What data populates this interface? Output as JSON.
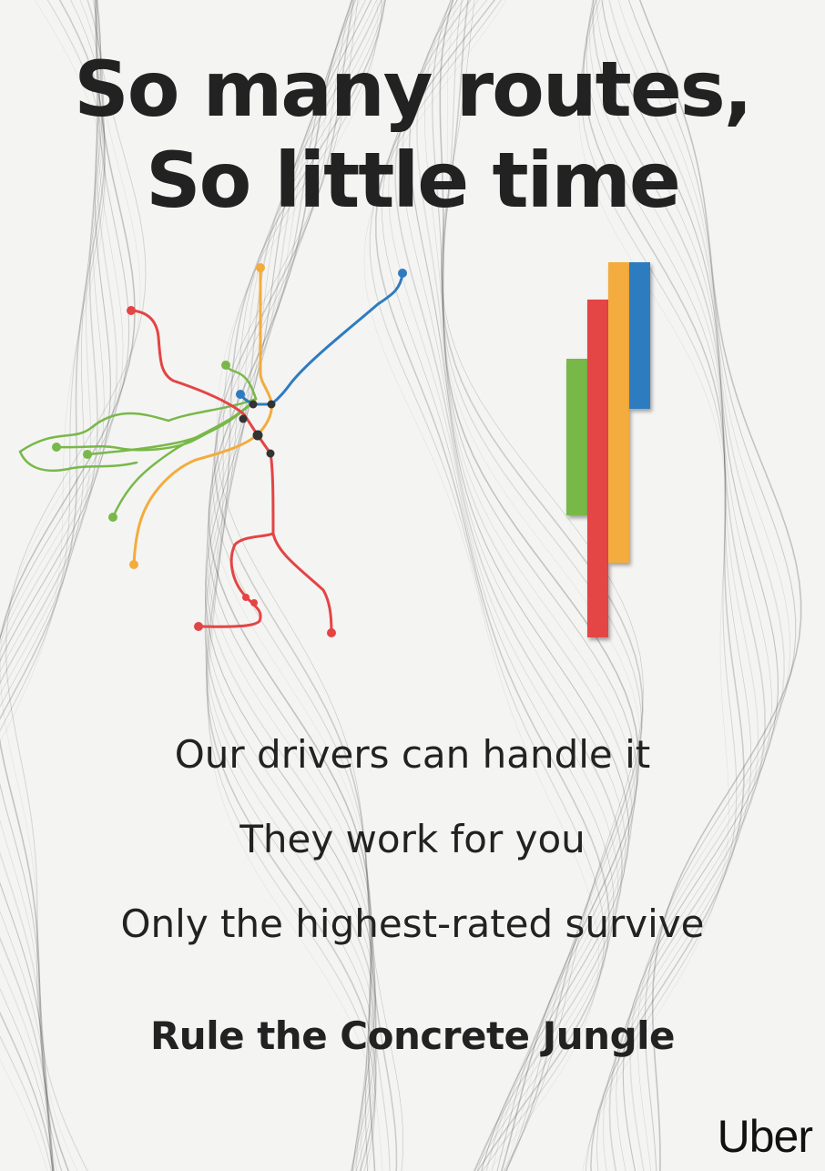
{
  "poster": {
    "headline_line1": "So many routes,",
    "headline_line2": "So little time",
    "tagline_1": "Our drivers can handle it",
    "tagline_2": "They work for you",
    "tagline_3": "Only the highest-rated survive",
    "call_to_action": "Rule the Concrete Jungle",
    "brand": "Uber"
  },
  "colors": {
    "background": "#f4f4f3",
    "text": "#222222",
    "red": "#e44444",
    "orange": "#f3ac3c",
    "green": "#78b848",
    "blue": "#2f7bc0",
    "station": "#333333"
  }
}
